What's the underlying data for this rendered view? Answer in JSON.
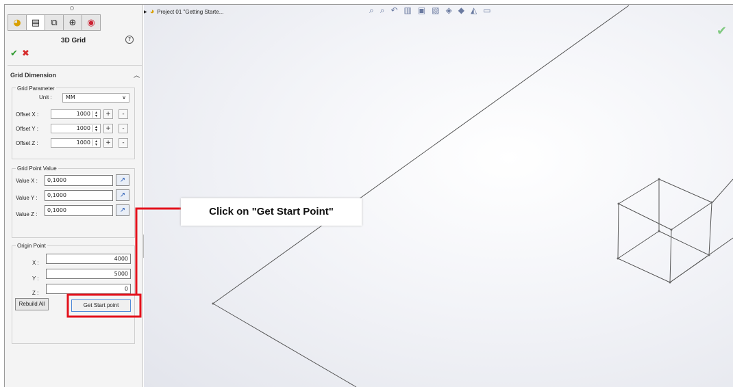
{
  "panel": {
    "tabs": [
      {
        "icon": "part-icon",
        "glyph": "◕"
      },
      {
        "icon": "property-manager-icon",
        "glyph": "▤"
      },
      {
        "icon": "configuration-icon",
        "glyph": "⧉"
      },
      {
        "icon": "dimxpert-icon",
        "glyph": "⊕"
      },
      {
        "icon": "display-manager-icon",
        "glyph": "◉"
      }
    ],
    "title": "3D Grid",
    "help_glyph": "?",
    "ok_glyph": "✔",
    "cancel_glyph": "✖",
    "section_title": "Grid Dimension",
    "grid_parameter": {
      "label": "Grid Parameter",
      "unit_label": "Unit :",
      "unit_value": "MM",
      "offsets": [
        {
          "label": "Offset X :",
          "value": "1000"
        },
        {
          "label": "Offset Y :",
          "value": "1000"
        },
        {
          "label": "Offset Z :",
          "value": "1000"
        }
      ],
      "plus": "+",
      "minus": "-"
    },
    "grid_point_value": {
      "label": "Grid Point Value",
      "values": [
        {
          "label": "Value X :",
          "value": "0,1000"
        },
        {
          "label": "Value Y :",
          "value": "0,1000"
        },
        {
          "label": "Value Z :",
          "value": "0,1000"
        }
      ]
    },
    "origin_point": {
      "label": "Origin Point",
      "coords": [
        {
          "label": "X :",
          "value": "4000"
        },
        {
          "label": "Y :",
          "value": "5000"
        },
        {
          "label": "Z :",
          "value": "0"
        }
      ]
    },
    "rebuild_button": "Rebuild All",
    "start_button": "Get Start point"
  },
  "tree": {
    "label": "Project 01 \"Getting Starte..."
  },
  "callout": "Click on \"Get Start Point\"",
  "colors": {
    "annotation": "#e3111b",
    "accent": "#4f8ad8",
    "ok": "#2e9a2e",
    "cancel": "#d62b2b"
  }
}
